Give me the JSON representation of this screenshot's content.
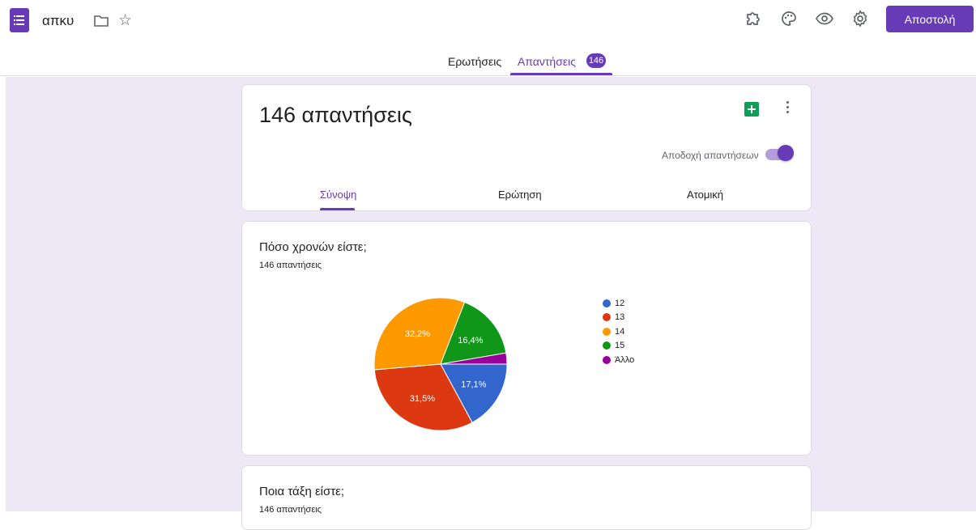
{
  "header": {
    "doc_title": "απκυ",
    "send_label": "Αποστολή"
  },
  "nav": {
    "tabs": [
      {
        "label": "Ερωτήσεις",
        "active": false
      },
      {
        "label": "Απαντήσεις",
        "active": true
      }
    ],
    "responses_badge": "146"
  },
  "summary": {
    "title": "146 απαντήσεις",
    "accept_label": "Αποδοχή απαντήσεων",
    "accepting": true,
    "sub_tabs": [
      {
        "label": "Σύνοψη",
        "active": true
      },
      {
        "label": "Ερώτηση",
        "active": false
      },
      {
        "label": "Ατομική",
        "active": false
      }
    ]
  },
  "questions": [
    {
      "title": "Πόσο χρονών είστε;",
      "count": "146 απαντήσεις"
    },
    {
      "title": "Ποια τάξη είστε;",
      "count": "146 απαντήσεις"
    }
  ],
  "chart_data": {
    "type": "pie",
    "categories": [
      "12",
      "13",
      "14",
      "15",
      "Άλλο"
    ],
    "values": [
      17.1,
      31.5,
      32.2,
      16.4,
      2.7
    ],
    "labels": [
      "17,1%",
      "31,5%",
      "32,2%",
      "16,4%",
      ""
    ],
    "colors": [
      "#3366cc",
      "#dc3912",
      "#ff9900",
      "#109618",
      "#990099"
    ],
    "legend_position": "right"
  },
  "theme": {
    "accent": "#673ab7",
    "background": "#ede7f6"
  }
}
